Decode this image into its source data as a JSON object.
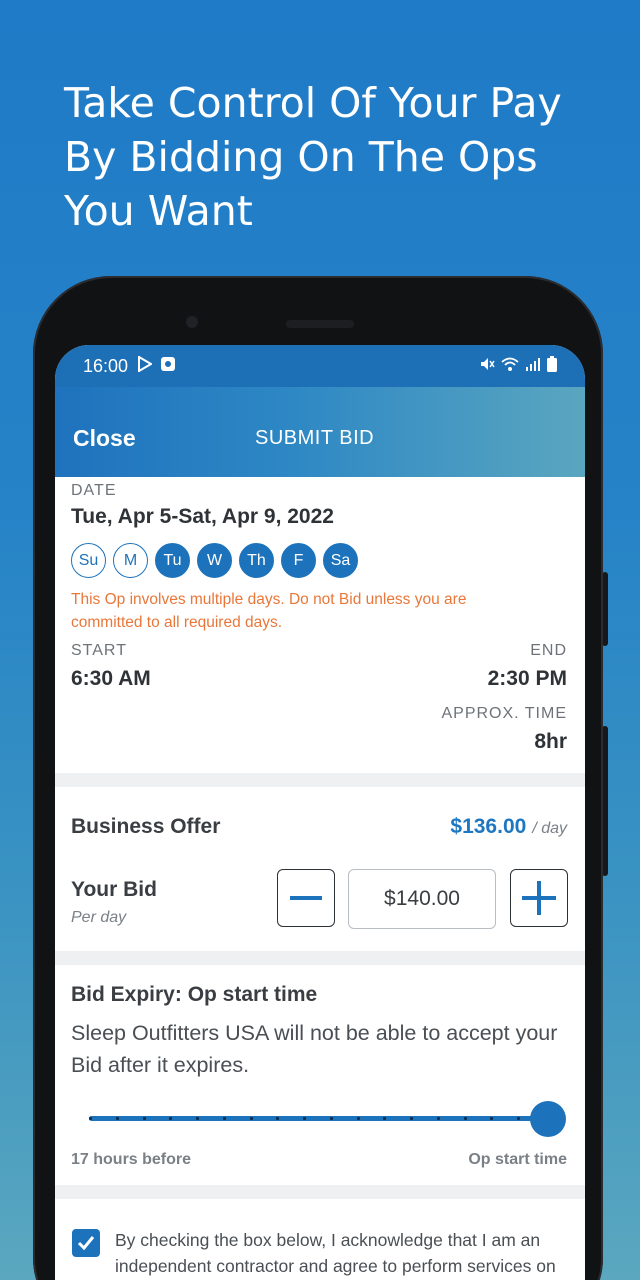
{
  "headline": "Take Control Of Your Pay By Bidding On The Ops You Want",
  "status_bar": {
    "time": "16:00",
    "icons_left": [
      "play-store-icon",
      "notification-icon"
    ],
    "icons_right": [
      "mute-icon",
      "wifi-icon",
      "signal-icon",
      "battery-icon"
    ]
  },
  "app_bar": {
    "close_label": "Close",
    "title": "SUBMIT BID"
  },
  "op": {
    "date_label": "DATE",
    "date_value": "Tue, Apr 5-Sat, Apr 9, 2022",
    "days": [
      {
        "label": "Su",
        "selected": false
      },
      {
        "label": "M",
        "selected": false
      },
      {
        "label": "Tu",
        "selected": true
      },
      {
        "label": "W",
        "selected": true
      },
      {
        "label": "Th",
        "selected": true
      },
      {
        "label": "F",
        "selected": true
      },
      {
        "label": "Sa",
        "selected": true
      }
    ],
    "warning": "This Op involves multiple days. Do not Bid unless you are committed to all required days.",
    "start_label": "START",
    "start_value": "6:30 AM",
    "end_label": "END",
    "end_value": "2:30 PM",
    "approx_label": "APPROX. TIME",
    "approx_value": "8hr"
  },
  "offer": {
    "label": "Business Offer",
    "value": "$136.00",
    "unit": "/ day"
  },
  "bid": {
    "label": "Your Bid",
    "sublabel": "Per day",
    "value": "$140.00"
  },
  "expiry": {
    "title": "Bid Expiry: Op start time",
    "description": "Sleep Outfitters USA will not be able to accept your Bid after it expires.",
    "range_min": "17 hours before",
    "range_max": "Op start time",
    "slider_fraction": 1.0
  },
  "acknowledgement": {
    "checked": true,
    "text": "By checking the box below, I acknowledge that I am an independent contractor and agree to perform services on behalf of Sleep Outfitters USA pursuant"
  },
  "colors": {
    "primary": "#1d73bb",
    "price": "#1d78c1",
    "warning": "#e8773a"
  }
}
